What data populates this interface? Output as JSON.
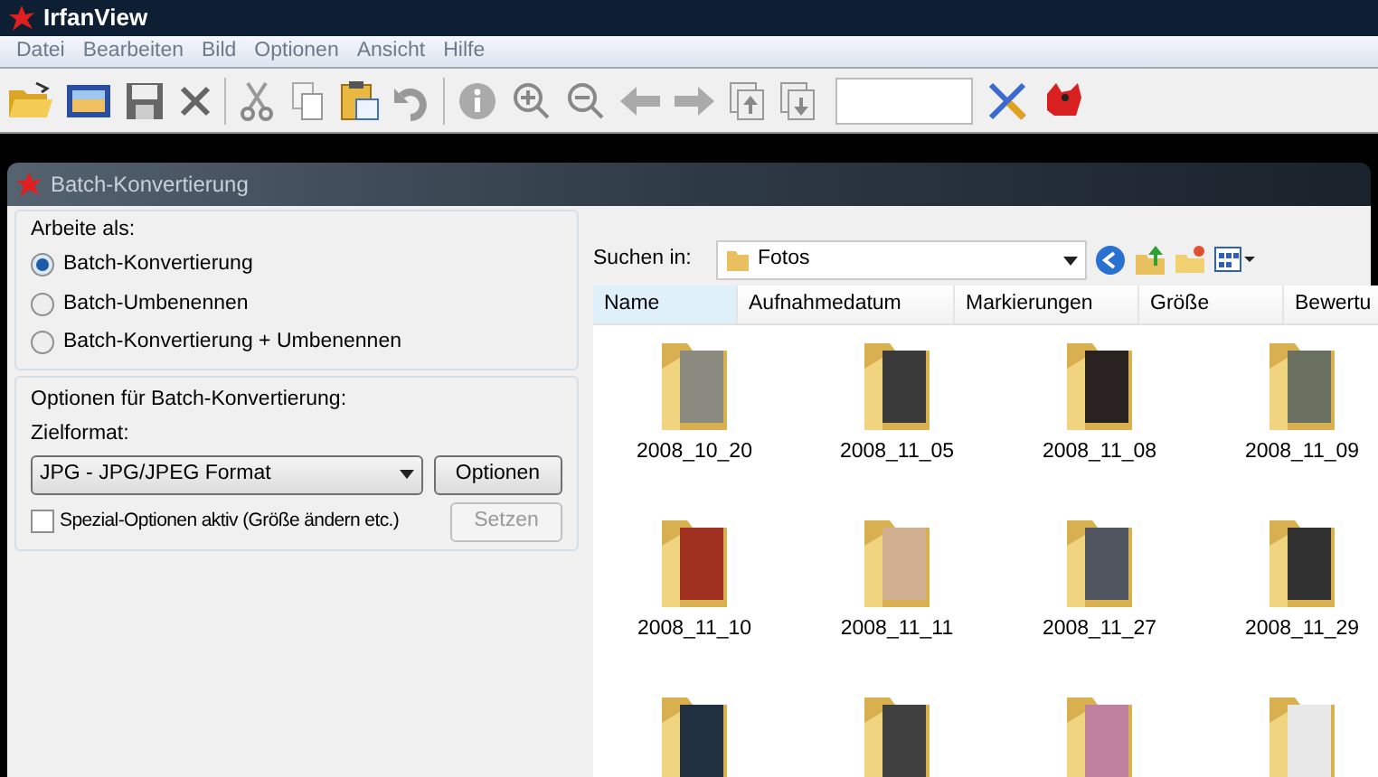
{
  "window": {
    "title": "IrfanView"
  },
  "menu": [
    "Datei",
    "Bearbeiten",
    "Bild",
    "Optionen",
    "Ansicht",
    "Hilfe"
  ],
  "dialog": {
    "title": "Batch-Konvertierung",
    "work_group": {
      "legend": "Arbeite als:",
      "options": [
        {
          "label": "Batch-Konvertierung",
          "selected": true
        },
        {
          "label": "Batch-Umbenennen",
          "selected": false
        },
        {
          "label": "Batch-Konvertierung + Umbenennen",
          "selected": false
        }
      ]
    },
    "options_group": {
      "legend": "Optionen für Batch-Konvertierung:",
      "format_label": "Zielformat:",
      "format_value": "JPG - JPG/JPEG Format",
      "options_button": "Optionen",
      "special_checkbox": {
        "label": "Spezial-Optionen aktiv (Größe ändern etc.)",
        "checked": false
      },
      "set_button": {
        "label": "Setzen",
        "disabled": true
      }
    },
    "look_in": {
      "label": "Suchen in:",
      "value": "Fotos"
    },
    "columns": [
      {
        "label": "Name",
        "selected": true
      },
      {
        "label": "Aufnahmedatum",
        "selected": false
      },
      {
        "label": "Markierungen",
        "selected": false
      },
      {
        "label": "Größe",
        "selected": false
      },
      {
        "label": "Bewertu",
        "selected": false
      }
    ],
    "folders": [
      {
        "label": "2008_10_20",
        "color": "#8a8a80"
      },
      {
        "label": "2008_11_05",
        "color": "#3a3a3a"
      },
      {
        "label": "2008_11_08",
        "color": "#2a2220"
      },
      {
        "label": "2008_11_09",
        "color": "#6a7060"
      },
      {
        "label": "2008_11_10",
        "color": "#a03020"
      },
      {
        "label": "2008_11_11",
        "color": "#d0b090"
      },
      {
        "label": "2008_11_27",
        "color": "#505560"
      },
      {
        "label": "2008_11_29",
        "color": "#303030"
      },
      {
        "color": "#203040"
      },
      {
        "color": "#404040"
      },
      {
        "color": "#c080a0"
      },
      {
        "color": "#e8e8e8"
      }
    ]
  }
}
